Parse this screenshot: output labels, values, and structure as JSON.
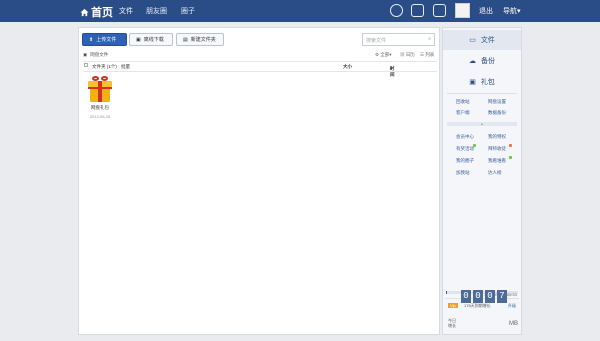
{
  "topbar": {
    "logo": "首页",
    "nav": [
      "文件",
      "朋友圈",
      "圈子"
    ],
    "logout": "退出",
    "guide": "导航"
  },
  "toolbar": {
    "upload": "上传文件",
    "offline": "离线下载",
    "newfolder": "新建文件夹",
    "search_placeholder": "搜索文件"
  },
  "crumb": "网盘文件",
  "view": {
    "all": "全部",
    "day": "日历",
    "list": "列表"
  },
  "table": {
    "name": "文件夹 (1个)",
    "bulk": "批量",
    "size": "大小",
    "time": "时间"
  },
  "files": [
    {
      "name": "网盘礼包",
      "date": "2013-06-28"
    }
  ],
  "sidebar": {
    "tabs": [
      "文件",
      "备份",
      "礼包"
    ],
    "links_a": [
      "回收站",
      "网盘设置",
      "客户端",
      "数据备份"
    ],
    "links_b": [
      "会员中心",
      "我的特权",
      "有奖活动",
      "拜师收徒",
      "我的圈子",
      "我看谁看",
      "加我站",
      "达人榜"
    ],
    "quota": "2.63GB/216.86GB",
    "badge": "Vip",
    "growth": "178天到期增长",
    "upgrade": "升级",
    "today_label": "今日增长",
    "digits": [
      "0",
      "0",
      "0",
      "7"
    ],
    "unit": "MB"
  },
  "colors": {
    "brand": "#2b4d87",
    "accent": "#2e60b4"
  }
}
